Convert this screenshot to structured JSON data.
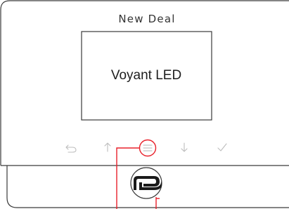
{
  "device": {
    "brand_text": "New Deal",
    "screen_label": "Voyant LED",
    "logo_icon": "nd-logo-icon"
  },
  "buttons": [
    {
      "name": "back-button",
      "icon": "back-arrow-icon"
    },
    {
      "name": "up-button",
      "icon": "up-arrow-icon"
    },
    {
      "name": "menu-button",
      "icon": "menu-icon",
      "highlighted": true
    },
    {
      "name": "down-button",
      "icon": "down-arrow-icon"
    },
    {
      "name": "confirm-button",
      "icon": "checkmark-icon"
    }
  ],
  "colors": {
    "callout": "#e8202a",
    "outline": "#3a3a3a",
    "button_glyph": "#bdbdbd"
  }
}
